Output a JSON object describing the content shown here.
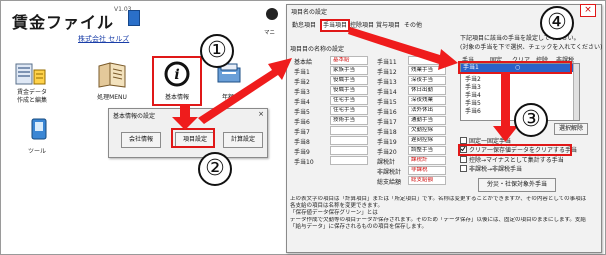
{
  "app": {
    "title": "賃金ファイル",
    "version": "V1.03",
    "company": "株式会社 セルズ",
    "icons": [
      {
        "label": "賃金データ\n作成と編集",
        "name": "wage-data-icon"
      },
      {
        "label": "処理MENU",
        "name": "process-menu-icon"
      },
      {
        "label": "基本情報",
        "name": "basic-info-icon"
      },
      {
        "label": "年額",
        "name": "annual-icon"
      },
      {
        "label": "ツール",
        "name": "tool-icon"
      }
    ],
    "partial_label_right": "マニ"
  },
  "basic_dialog": {
    "title": "基本情報の設定",
    "buttons": [
      "会社情報",
      "項目設定",
      "計算設定"
    ]
  },
  "item_dialog": {
    "title": "項目名の設定",
    "close": "×",
    "tabs": [
      "勤怠項目",
      "手当項目",
      "控除項目",
      "賞与項目",
      "その他"
    ],
    "section_title": "項目目の名称の設定",
    "left_col": [
      {
        "label": "基本給",
        "value": "基本給",
        "red": true
      },
      {
        "label": "手当1",
        "value": "家族手当",
        "red": false
      },
      {
        "label": "手当2",
        "value": "役職手当",
        "red": false
      },
      {
        "label": "手当3",
        "value": "役職手当",
        "red": false
      },
      {
        "label": "手当4",
        "value": "住宅手当",
        "red": false
      },
      {
        "label": "手当5",
        "value": "住宅手当",
        "red": false
      },
      {
        "label": "手当6",
        "value": "技術手当",
        "red": false
      },
      {
        "label": "手当7",
        "value": "",
        "red": false
      },
      {
        "label": "手当8",
        "value": "",
        "red": false
      },
      {
        "label": "手当9",
        "value": "",
        "red": false
      },
      {
        "label": "手当10",
        "value": "",
        "red": false
      }
    ],
    "right_col": [
      {
        "label": "手当11",
        "value": "",
        "red": false
      },
      {
        "label": "手当12",
        "value": "残業手当",
        "red": false
      },
      {
        "label": "手当13",
        "value": "深夜手当",
        "red": false
      },
      {
        "label": "手当14",
        "value": "休日出勤",
        "red": false
      },
      {
        "label": "手当15",
        "value": "深夜残業",
        "red": false
      },
      {
        "label": "手当16",
        "value": "法外休出",
        "red": false
      },
      {
        "label": "手当17",
        "value": "通勤手当",
        "red": false
      },
      {
        "label": "手当18",
        "value": "欠勤控除",
        "red": false
      },
      {
        "label": "手当19",
        "value": "遅刻控除",
        "red": false
      },
      {
        "label": "手当20",
        "value": "調整手当",
        "red": false
      },
      {
        "label": "課税計",
        "value": "課税計",
        "red": true
      },
      {
        "label": "非課税計",
        "value": "非課税",
        "red": true
      },
      {
        "label": "総支給額",
        "value": "総支給額",
        "red": true
      }
    ],
    "notes": [
      "上の表文字の項目は「計算項目」または「所定項目」です。名称は変更することができますが、その内容としての事項はできません。",
      "各支給の項目は名称を変更できます。",
      "「保存値データ保存グリーン」とは",
      "データ作成で欠勤等の項目データが保存されます。そのため「データ保存」以後には、固定の項目のままにします。支給手当は項目を選択すると、以前に支給した額を保存します。",
      "「給与データ」に保存されるものの項目を保存します。"
    ],
    "right_panel": {
      "instruction": "下記項目に該当の手当を設定してください。",
      "instruction2": "(対象の手当を下で選択、チェックを入れてください)",
      "list_headers": [
        "手当",
        "固定",
        "クリア",
        "控除",
        "非課税"
      ],
      "list_rows": [
        "手当1",
        "手当2",
        "手当3",
        "手当4",
        "手当5",
        "手当6"
      ],
      "check_fixed": "固定一固定手当",
      "check_clear": "クリア一保存値データをクリアする手当",
      "check_deduct": "控除→マイナスとして集計する手当",
      "check_nontax": "非課税→非課税手当",
      "button_reset": "選択解除",
      "button_bottom": "労災・社保対象外手当"
    }
  },
  "annotations": [
    "①",
    "②",
    "③",
    "④"
  ]
}
